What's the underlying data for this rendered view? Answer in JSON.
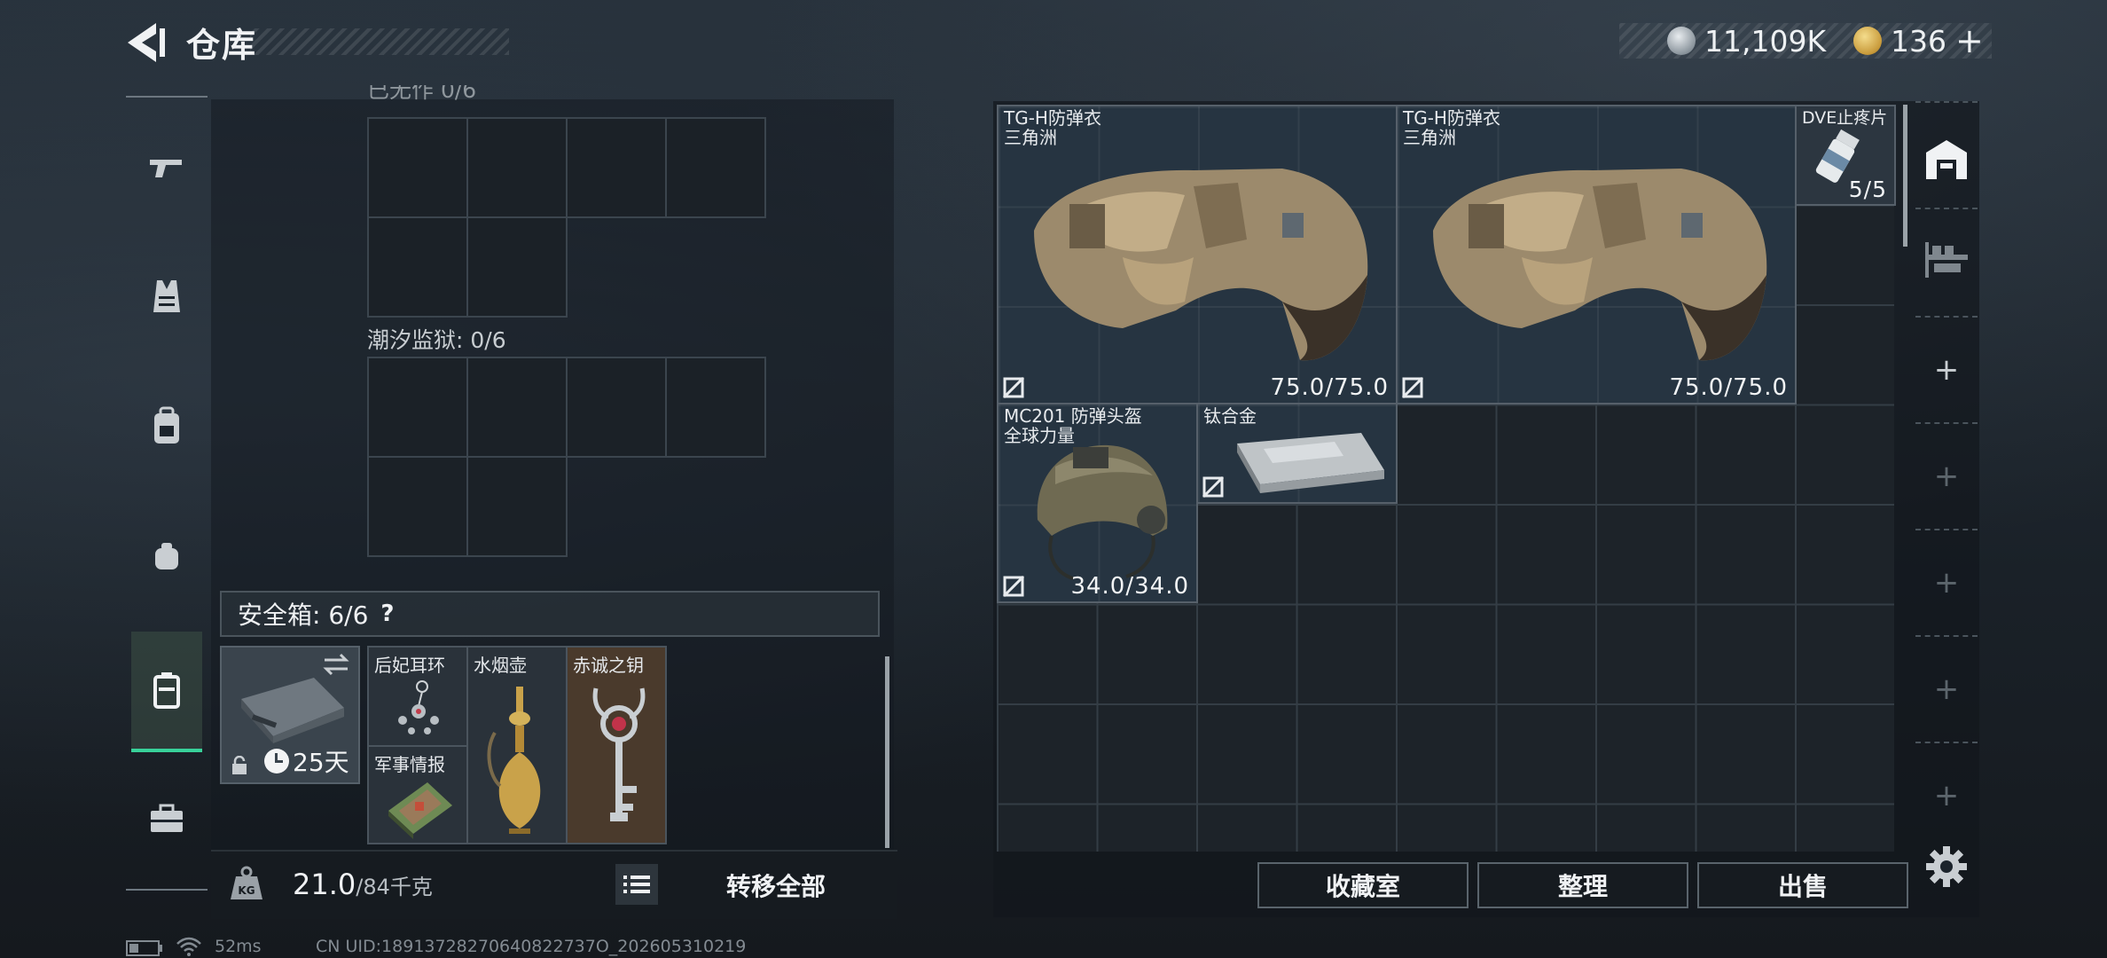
{
  "header": {
    "title": "仓库",
    "currency_silver": "11,109K",
    "currency_gold": "136",
    "plus_label": "+"
  },
  "left_rail": {
    "items": [
      {
        "icon": "gun-icon"
      },
      {
        "icon": "vest-icon"
      },
      {
        "icon": "backpack-icon"
      },
      {
        "icon": "pouch-icon"
      },
      {
        "icon": "safe-case-icon",
        "active": true
      },
      {
        "icon": "briefcase-icon"
      }
    ]
  },
  "containers": {
    "top_partial_label": "已无作 0/6",
    "tide_prison_label": "潮汐监狱: 0/6"
  },
  "safe_box": {
    "header": "安全箱: 6/6",
    "help": "?",
    "days": "25天",
    "items": [
      {
        "name": "后妃耳环"
      },
      {
        "name": "水烟壶"
      },
      {
        "name": "赤诚之钥"
      },
      {
        "name": "军事情报"
      }
    ]
  },
  "weight": {
    "current": "21.0",
    "max": "/84千克",
    "transfer_all": "转移全部"
  },
  "stash": {
    "items": [
      {
        "name": "TG-H防弹衣",
        "sub": "三角洲",
        "durability": "75.0/75.0"
      },
      {
        "name": "TG-H防弹衣",
        "sub": "三角洲",
        "durability": "75.0/75.0"
      },
      {
        "name": "DVE止疼片",
        "count": "5/5"
      },
      {
        "name": "MC201 防弹头盔",
        "sub": "全球力量",
        "durability": "34.0/34.0"
      },
      {
        "name": "钛合金"
      }
    ],
    "buttons": {
      "collection": "收藏室",
      "organize": "整理",
      "sell": "出售"
    }
  },
  "status": {
    "ping": "52ms",
    "uid": "CN UID:18913728270640822737O_202605310219"
  },
  "colors": {
    "accent": "#38d29a",
    "gold_item_bg": "#4a3a2c",
    "stash_item_bg": "#263441"
  }
}
